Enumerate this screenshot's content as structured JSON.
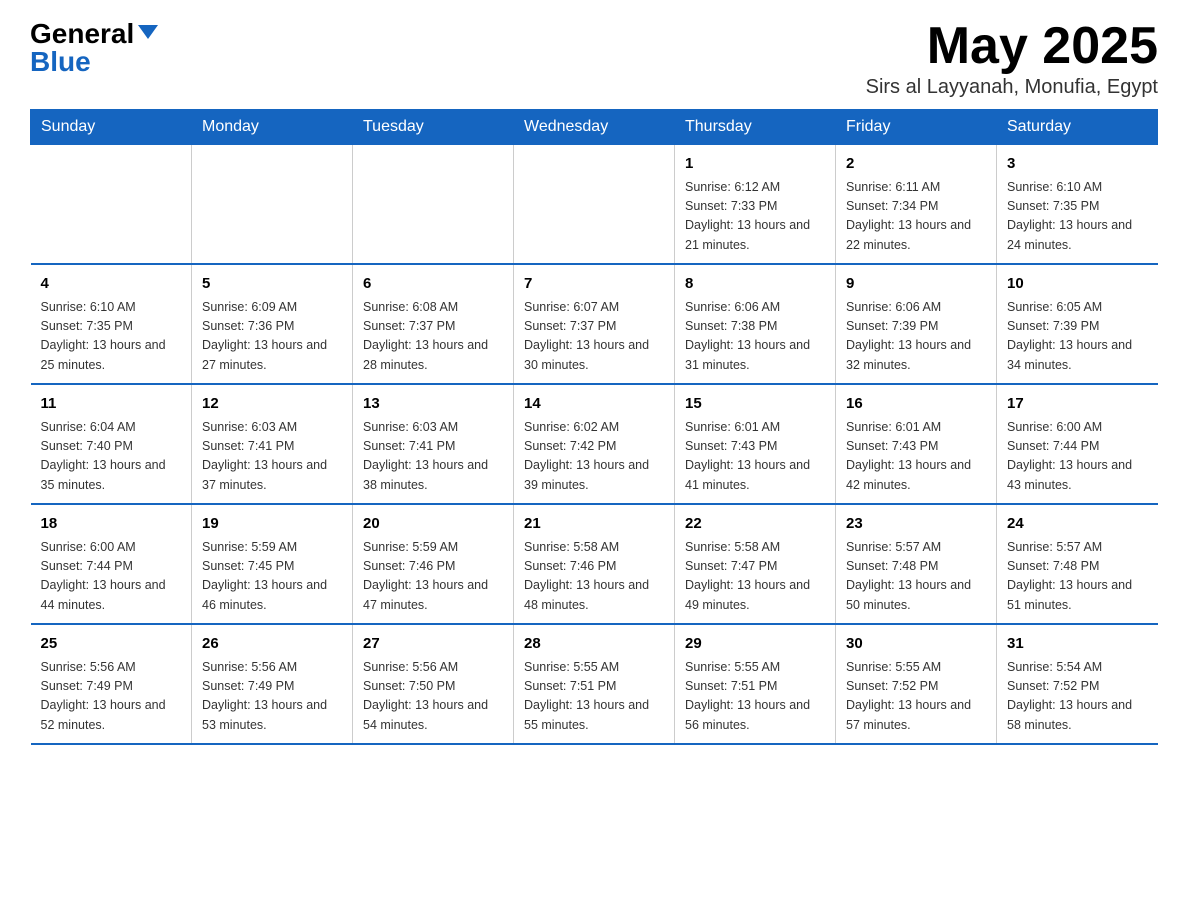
{
  "logo": {
    "general": "General",
    "blue": "Blue"
  },
  "title": "May 2025",
  "location": "Sirs al Layyanah, Monufia, Egypt",
  "days_header": [
    "Sunday",
    "Monday",
    "Tuesday",
    "Wednesday",
    "Thursday",
    "Friday",
    "Saturday"
  ],
  "weeks": [
    [
      {
        "day": "",
        "info": ""
      },
      {
        "day": "",
        "info": ""
      },
      {
        "day": "",
        "info": ""
      },
      {
        "day": "",
        "info": ""
      },
      {
        "day": "1",
        "info": "Sunrise: 6:12 AM\nSunset: 7:33 PM\nDaylight: 13 hours and 21 minutes."
      },
      {
        "day": "2",
        "info": "Sunrise: 6:11 AM\nSunset: 7:34 PM\nDaylight: 13 hours and 22 minutes."
      },
      {
        "day": "3",
        "info": "Sunrise: 6:10 AM\nSunset: 7:35 PM\nDaylight: 13 hours and 24 minutes."
      }
    ],
    [
      {
        "day": "4",
        "info": "Sunrise: 6:10 AM\nSunset: 7:35 PM\nDaylight: 13 hours and 25 minutes."
      },
      {
        "day": "5",
        "info": "Sunrise: 6:09 AM\nSunset: 7:36 PM\nDaylight: 13 hours and 27 minutes."
      },
      {
        "day": "6",
        "info": "Sunrise: 6:08 AM\nSunset: 7:37 PM\nDaylight: 13 hours and 28 minutes."
      },
      {
        "day": "7",
        "info": "Sunrise: 6:07 AM\nSunset: 7:37 PM\nDaylight: 13 hours and 30 minutes."
      },
      {
        "day": "8",
        "info": "Sunrise: 6:06 AM\nSunset: 7:38 PM\nDaylight: 13 hours and 31 minutes."
      },
      {
        "day": "9",
        "info": "Sunrise: 6:06 AM\nSunset: 7:39 PM\nDaylight: 13 hours and 32 minutes."
      },
      {
        "day": "10",
        "info": "Sunrise: 6:05 AM\nSunset: 7:39 PM\nDaylight: 13 hours and 34 minutes."
      }
    ],
    [
      {
        "day": "11",
        "info": "Sunrise: 6:04 AM\nSunset: 7:40 PM\nDaylight: 13 hours and 35 minutes."
      },
      {
        "day": "12",
        "info": "Sunrise: 6:03 AM\nSunset: 7:41 PM\nDaylight: 13 hours and 37 minutes."
      },
      {
        "day": "13",
        "info": "Sunrise: 6:03 AM\nSunset: 7:41 PM\nDaylight: 13 hours and 38 minutes."
      },
      {
        "day": "14",
        "info": "Sunrise: 6:02 AM\nSunset: 7:42 PM\nDaylight: 13 hours and 39 minutes."
      },
      {
        "day": "15",
        "info": "Sunrise: 6:01 AM\nSunset: 7:43 PM\nDaylight: 13 hours and 41 minutes."
      },
      {
        "day": "16",
        "info": "Sunrise: 6:01 AM\nSunset: 7:43 PM\nDaylight: 13 hours and 42 minutes."
      },
      {
        "day": "17",
        "info": "Sunrise: 6:00 AM\nSunset: 7:44 PM\nDaylight: 13 hours and 43 minutes."
      }
    ],
    [
      {
        "day": "18",
        "info": "Sunrise: 6:00 AM\nSunset: 7:44 PM\nDaylight: 13 hours and 44 minutes."
      },
      {
        "day": "19",
        "info": "Sunrise: 5:59 AM\nSunset: 7:45 PM\nDaylight: 13 hours and 46 minutes."
      },
      {
        "day": "20",
        "info": "Sunrise: 5:59 AM\nSunset: 7:46 PM\nDaylight: 13 hours and 47 minutes."
      },
      {
        "day": "21",
        "info": "Sunrise: 5:58 AM\nSunset: 7:46 PM\nDaylight: 13 hours and 48 minutes."
      },
      {
        "day": "22",
        "info": "Sunrise: 5:58 AM\nSunset: 7:47 PM\nDaylight: 13 hours and 49 minutes."
      },
      {
        "day": "23",
        "info": "Sunrise: 5:57 AM\nSunset: 7:48 PM\nDaylight: 13 hours and 50 minutes."
      },
      {
        "day": "24",
        "info": "Sunrise: 5:57 AM\nSunset: 7:48 PM\nDaylight: 13 hours and 51 minutes."
      }
    ],
    [
      {
        "day": "25",
        "info": "Sunrise: 5:56 AM\nSunset: 7:49 PM\nDaylight: 13 hours and 52 minutes."
      },
      {
        "day": "26",
        "info": "Sunrise: 5:56 AM\nSunset: 7:49 PM\nDaylight: 13 hours and 53 minutes."
      },
      {
        "day": "27",
        "info": "Sunrise: 5:56 AM\nSunset: 7:50 PM\nDaylight: 13 hours and 54 minutes."
      },
      {
        "day": "28",
        "info": "Sunrise: 5:55 AM\nSunset: 7:51 PM\nDaylight: 13 hours and 55 minutes."
      },
      {
        "day": "29",
        "info": "Sunrise: 5:55 AM\nSunset: 7:51 PM\nDaylight: 13 hours and 56 minutes."
      },
      {
        "day": "30",
        "info": "Sunrise: 5:55 AM\nSunset: 7:52 PM\nDaylight: 13 hours and 57 minutes."
      },
      {
        "day": "31",
        "info": "Sunrise: 5:54 AM\nSunset: 7:52 PM\nDaylight: 13 hours and 58 minutes."
      }
    ]
  ]
}
